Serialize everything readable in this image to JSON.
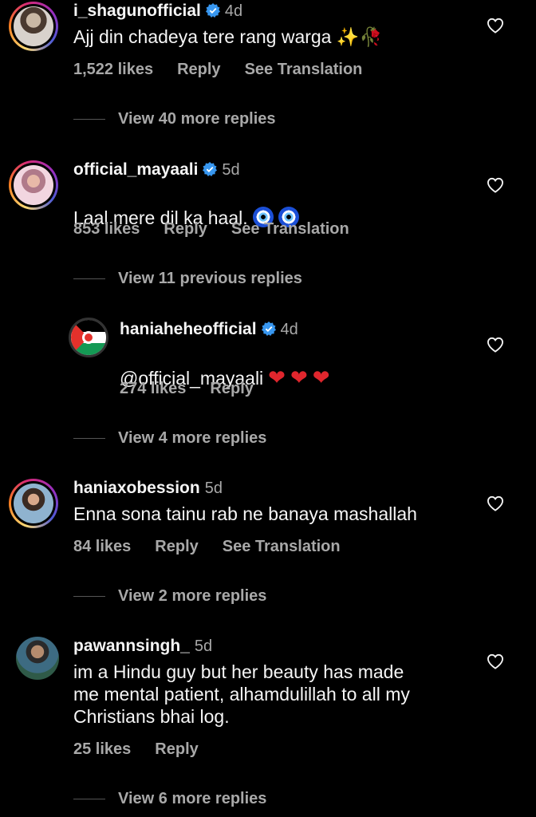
{
  "comments": [
    {
      "username": "i_shagunofficial",
      "verified": true,
      "time": "4d",
      "text": "Ajj din chadeya tere rang warga ✨🥀",
      "likes": "1,522 likes",
      "reply": "Reply",
      "translate": "See Translation",
      "view_more": "View 40 more replies"
    },
    {
      "username": "official_mayaali",
      "verified": true,
      "time": "5d",
      "text": "Laal mere dil ka haal.",
      "likes": "853 likes",
      "reply": "Reply",
      "translate": "See Translation",
      "view_more": "View 11 previous replies"
    },
    {
      "username": "haniaheheofficial",
      "verified": true,
      "time": "4d",
      "text": "@official_mayaali",
      "likes": "274 likes",
      "reply": "Reply",
      "view_more": "View 4 more replies"
    },
    {
      "username": "haniaxobession",
      "verified": false,
      "time": "5d",
      "text": "Enna sona tainu rab ne banaya mashallah",
      "likes": "84 likes",
      "reply": "Reply",
      "translate": "See Translation",
      "view_more": "View 2 more replies"
    },
    {
      "username": "pawannsingh_",
      "verified": false,
      "time": "5d",
      "text": "im a Hindu guy but her beauty has made\nme mental patient, alhamdulillah to all my\nChristians bhai log.",
      "likes": "25 likes",
      "reply": "Reply",
      "view_more": "View 6 more replies"
    }
  ],
  "colors": {
    "background": "#000000",
    "secondary_text": "#a8a8a8",
    "verified": "#3897f0"
  }
}
